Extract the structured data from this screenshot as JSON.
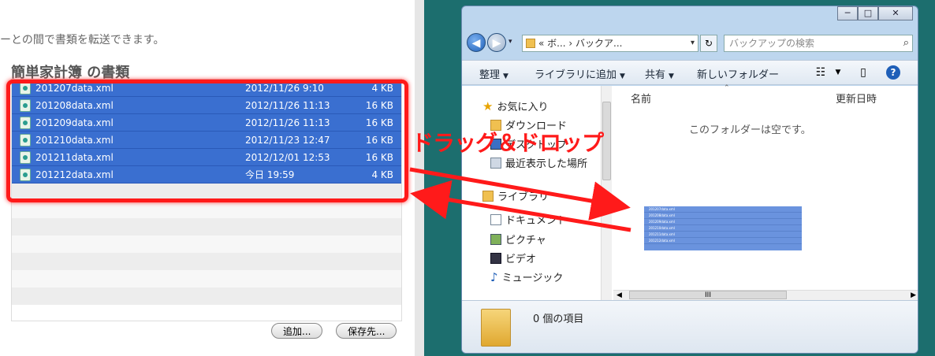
{
  "left_app": {
    "intro_text": "ーとの間で書類を転送できます。",
    "section_title": "簡単家計簿 の書類",
    "files": [
      {
        "name": "201207data.xml",
        "date": "2012/11/26 9:10",
        "size": "4 KB"
      },
      {
        "name": "201208data.xml",
        "date": "2012/11/26 11:13",
        "size": "16 KB"
      },
      {
        "name": "201209data.xml",
        "date": "2012/11/26 11:13",
        "size": "16 KB"
      },
      {
        "name": "201210data.xml",
        "date": "2012/11/23 12:47",
        "size": "16 KB"
      },
      {
        "name": "201211data.xml",
        "date": "2012/12/01 12:53",
        "size": "16 KB"
      },
      {
        "name": "201212data.xml",
        "date": "今日 19:59",
        "size": "4 KB"
      }
    ],
    "add_button": "追加...",
    "save_button": "保存先..."
  },
  "annotation": {
    "drag_drop_label": "ドラッグ＆ドロップ",
    "accent_color": "#ff1a1a"
  },
  "explorer": {
    "caption": {
      "minimize": "─",
      "maximize": "□",
      "close": "✕"
    },
    "address": {
      "prefix": "«",
      "path": "ボ... › バックア...",
      "dropdown": "▾"
    },
    "search_placeholder": "バックアップの検索",
    "toolbar": {
      "organize": "整理",
      "add_to_library": "ライブラリに追加",
      "share": "共有",
      "new_folder": "新しいフォルダー"
    },
    "nav": {
      "favorites": "お気に入り",
      "downloads": "ダウンロード",
      "desktop": "デスクトップ",
      "recent": "最近表示した場所",
      "libraries": "ライブラリ",
      "documents": "ドキュメント",
      "pictures": "ピクチャ",
      "videos": "ビデオ",
      "music": "ミュージック"
    },
    "columns": {
      "name": "名前",
      "modified": "更新日時"
    },
    "empty_message": "このフォルダーは空です。",
    "status_text": "0 個の項目",
    "hscroll_thumb": "III"
  }
}
